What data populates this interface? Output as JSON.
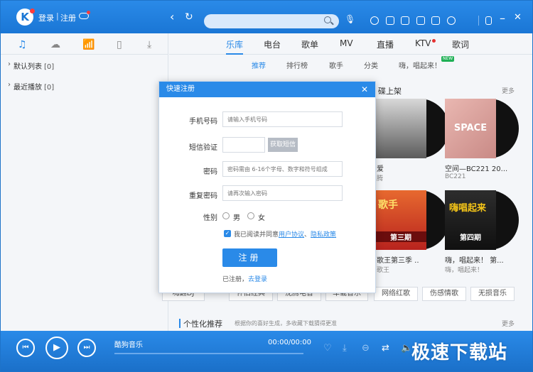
{
  "top": {
    "logo": "K",
    "login": "登录",
    "sep": "|",
    "register": "注册"
  },
  "sidebar": {
    "items": [
      {
        "label": "默认列表",
        "count": "[0]"
      },
      {
        "label": "最近播放",
        "count": "[0]"
      }
    ]
  },
  "main": {
    "tabs": [
      "乐库",
      "电台",
      "歌单",
      "MV",
      "直播",
      "KTV",
      "歌词"
    ],
    "subtabs": [
      "推荐",
      "排行榜",
      "歌手",
      "分类",
      "嗨，唱起来！"
    ],
    "new_badge": "NEW",
    "section1_title": "碟上架",
    "section1_more": "更多",
    "albums": [
      {
        "title": "空间—BC221 20...",
        "sub": "BC221"
      },
      {
        "title": "爱",
        "sub": "腾"
      },
      {
        "title": "嗨，唱起来！ 第...",
        "sub": "嗨，唱起来！"
      },
      {
        "title": "歌王第三季 ...",
        "sub": "歌王"
      }
    ],
    "cover_text": {
      "space": "SPACE",
      "ep3": "第三期",
      "ep4": "第四期",
      "singer": "歌手",
      "sing": "嗨唱起来"
    },
    "tags": [
      "嗨翻DJ",
      "怀旧经典",
      "沈腾电音",
      "车载音乐",
      "网络红歌",
      "伤感情歌",
      "无损音乐"
    ],
    "section2_title": "个性化推荐",
    "section2_desc": "根据你的喜好生成，多收藏下载猜得更准",
    "section2_more": "更多"
  },
  "player": {
    "song": "酷狗音乐",
    "time": "00:00/00:00",
    "watermark": "极速下载站"
  },
  "dialog": {
    "title": "快速注册",
    "phone_label": "手机号码",
    "phone_placeholder": "请输入手机号码",
    "sms_label": "短信验证",
    "get_code": "获取短信",
    "pwd_label": "密码",
    "pwd_placeholder": "密码需由 6-16个字母、数字和符号组成",
    "repwd_label": "重复密码",
    "repwd_placeholder": "请再次输入密码",
    "gender_label": "性别",
    "male": "男",
    "female": "女",
    "agree_text": "我已阅读并同意",
    "user_agreement": "用户协议",
    "comma": "、",
    "privacy": "隐私政策",
    "register_btn": "注册",
    "already": "已注册，",
    "go_login": "去登录"
  },
  "colors": {
    "accent": "#2a8ae8",
    "badge_red": "#ff3b3b"
  }
}
